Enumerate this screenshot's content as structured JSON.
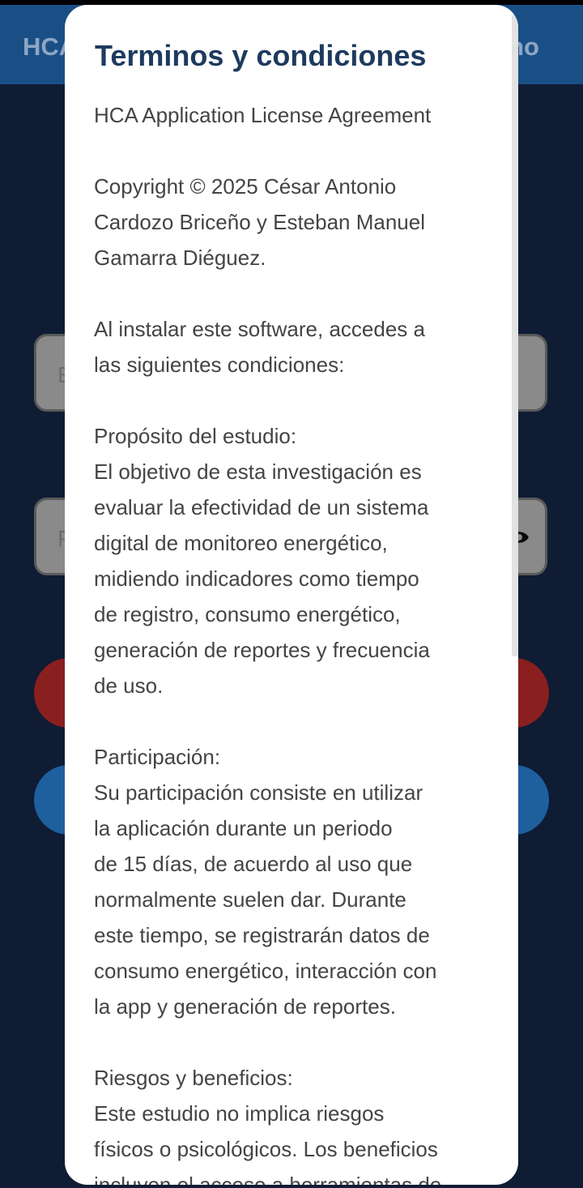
{
  "app_bar": {
    "title": "HCA",
    "action_fragment": "no"
  },
  "background_form": {
    "field_1_hint": "E",
    "field_2_hint": "P",
    "password_toggle_icon": "eye-icon"
  },
  "colors": {
    "app_bar": "#1a4f86",
    "screen_background": "#0f1c34",
    "dialog_title": "#1e3a5f",
    "dialog_body_text": "#444444",
    "primary_button": "#8a1f1f",
    "secondary_button": "#1e5f9e"
  },
  "dialog": {
    "title": "Terminos y condiciones",
    "paragraphs": [
      "HCA Application License Agreement",
      "Copyright © 2025 César Antonio\nCardozo Briceño y Esteban Manuel\nGamarra Diéguez.",
      "Al instalar este software, accedes a\nlas siguientes condiciones:",
      "Propósito del estudio:\nEl objetivo de esta investigación es\nevaluar la efectividad de un sistema\ndigital de monitoreo energético,\nmidiendo indicadores como tiempo\nde registro, consumo energético,\ngeneración de reportes y frecuencia\nde uso.",
      "Participación:\nSu participación consiste en utilizar\nla aplicación durante un periodo\nde 15 días, de acuerdo al uso que\nnormalmente suelen dar. Durante\neste tiempo, se registrarán datos de\nconsumo energético, interacción con\nla app y generación de reportes.",
      "Riesgos y beneficios:\nEste estudio no implica riesgos\nfísicos o psicológicos. Los beneficios\nincluyen el acceso a herramientas de"
    ]
  }
}
